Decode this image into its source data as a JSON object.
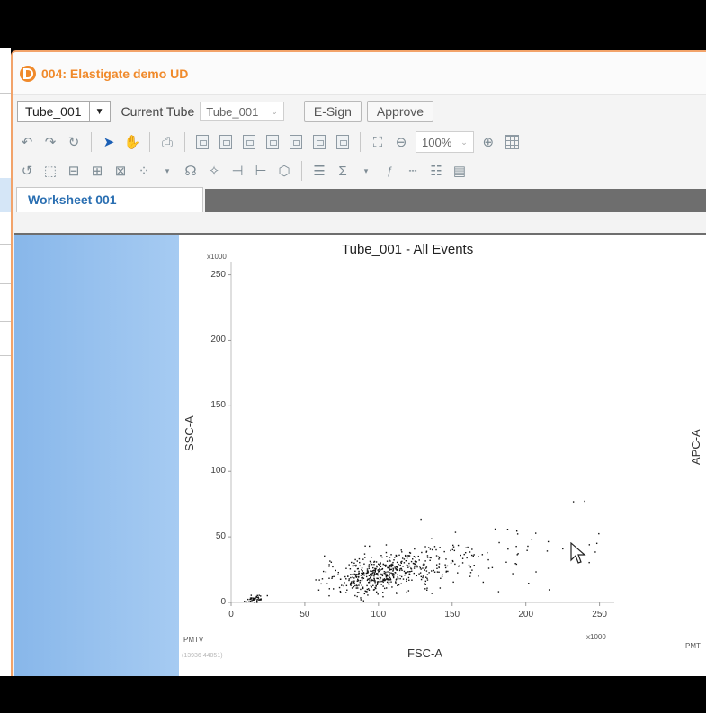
{
  "window": {
    "title": "004: Elastigate demo UD"
  },
  "tube_bar": {
    "tube_select": "Tube_001",
    "current_tube_label": "Current Tube",
    "current_tube_value": "Tube_001",
    "esign_label": "E-Sign",
    "approve_label": "Approve"
  },
  "toolbar": {
    "zoom": "100%"
  },
  "tabs": {
    "active": "Worksheet 001"
  },
  "plot1": {
    "title": "Tube_001 - All Events",
    "y_mult": "x1000",
    "x_mult": "x1000",
    "y_ticks": [
      "250",
      "200",
      "150",
      "100",
      "50",
      "0"
    ],
    "x_ticks": [
      "0",
      "50",
      "100",
      "150",
      "200",
      "250"
    ],
    "ylabel": "SSC-A",
    "xlabel": "FSC-A",
    "pmtv": "PMTV",
    "coords": "(13936 44051)"
  },
  "plot2": {
    "ylabel": "APC-A",
    "pmtv": "PMT"
  },
  "chart_data": {
    "type": "scatter",
    "title": "Tube_001 - All Events",
    "xlabel": "FSC-A",
    "ylabel": "SSC-A",
    "xlim": [
      0,
      260
    ],
    "ylim": [
      0,
      260
    ],
    "clusters": [
      {
        "x": 100,
        "y": 22,
        "sx": 18,
        "sy": 7,
        "n": 420
      },
      {
        "x": 130,
        "y": 28,
        "sx": 28,
        "sy": 9,
        "n": 160
      },
      {
        "x": 16,
        "y": 3,
        "sx": 3,
        "sy": 1.2,
        "n": 45
      },
      {
        "x": 190,
        "y": 45,
        "sx": 40,
        "sy": 18,
        "n": 40
      }
    ]
  }
}
